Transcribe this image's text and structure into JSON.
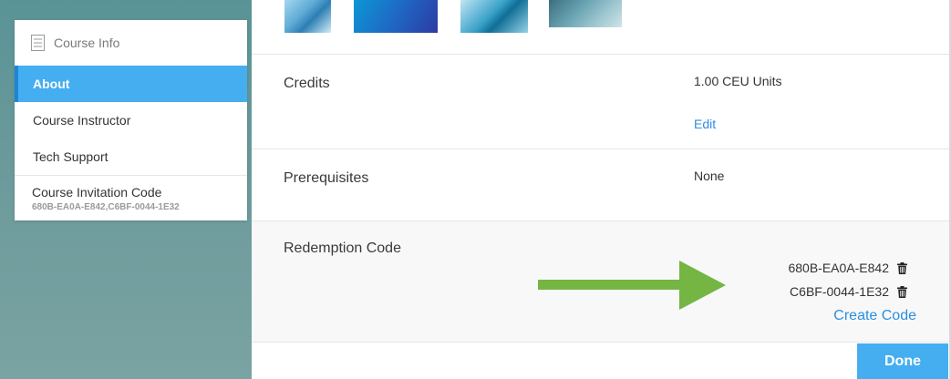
{
  "sidebar": {
    "header_icon": "document-icon",
    "header": "Course Info",
    "items": [
      {
        "label": "About"
      },
      {
        "label": "Course Instructor"
      },
      {
        "label": "Tech Support"
      }
    ],
    "invitation": {
      "label": "Course Invitation Code",
      "codes": "680B-EA0A-E842,C6BF-0044-1E32"
    }
  },
  "main": {
    "credits": {
      "label": "Credits",
      "value": "1.00 CEU Units",
      "edit": "Edit"
    },
    "prerequisites": {
      "label": "Prerequisites",
      "value": "None"
    },
    "redemption": {
      "label": "Redemption Code",
      "codes": [
        "680B-EA0A-E842",
        "C6BF-0044-1E32"
      ],
      "create": "Create Code"
    }
  },
  "footer": {
    "done": "Done"
  },
  "colors": {
    "accent": "#45aef0",
    "link": "#2b8fe0",
    "arrow": "#74b544"
  }
}
